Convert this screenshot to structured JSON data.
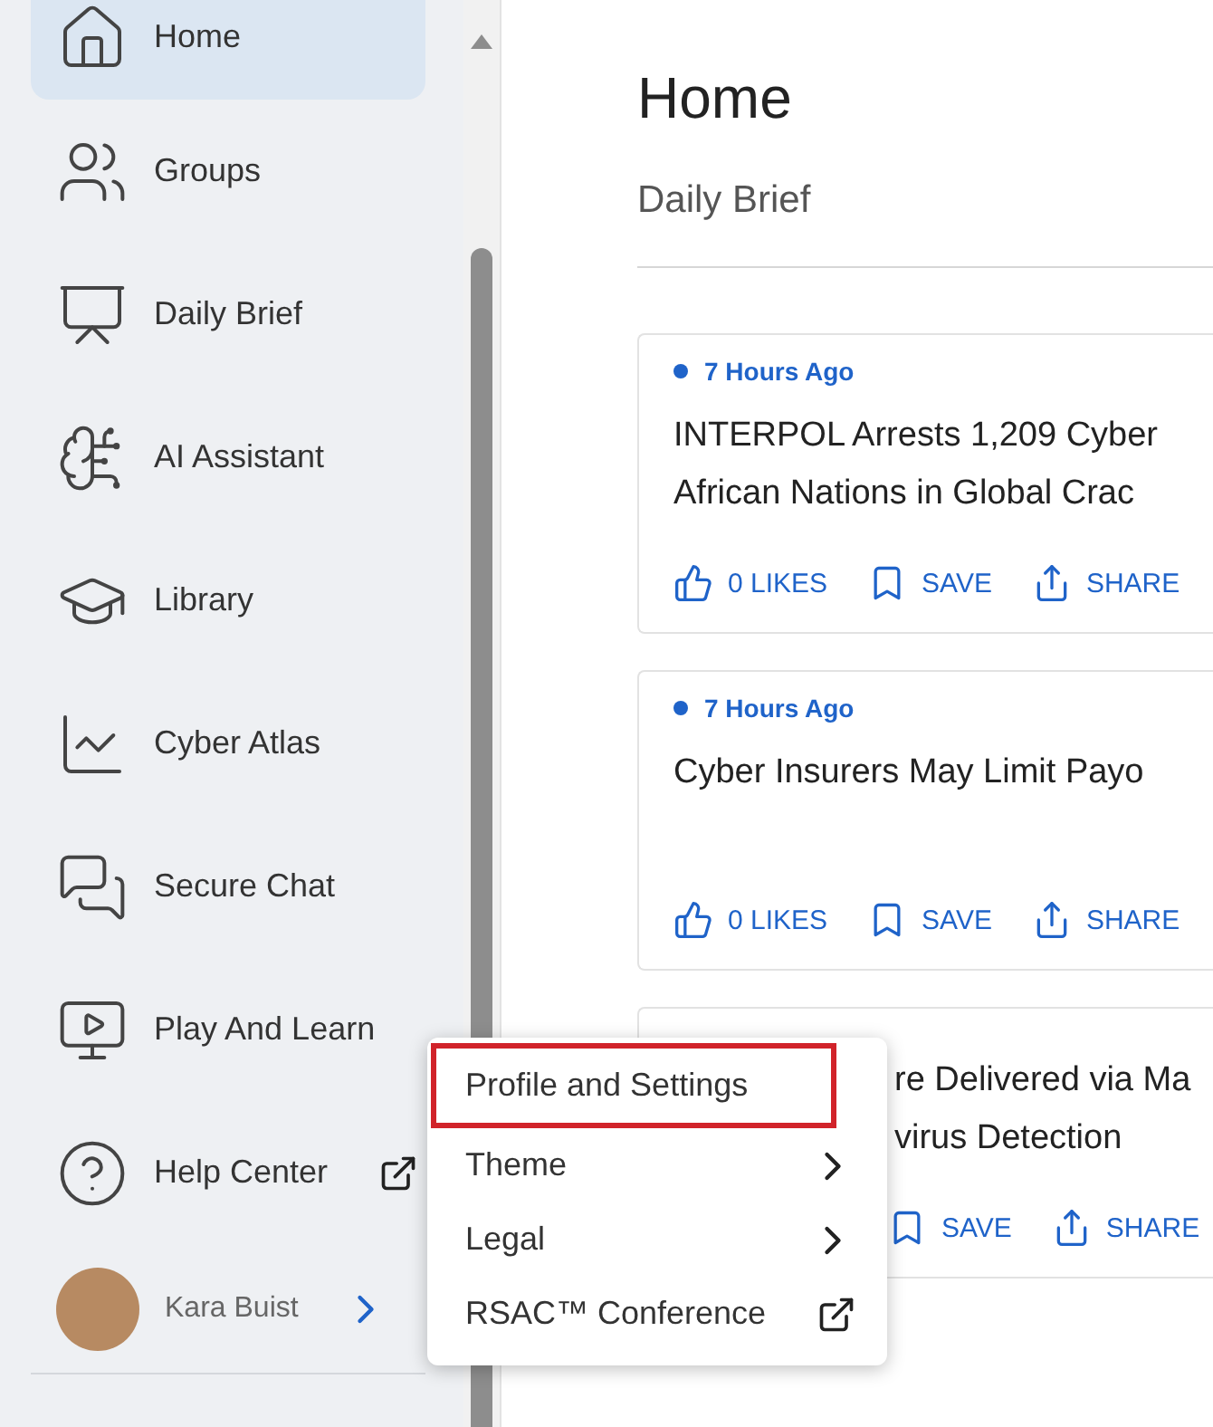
{
  "sidebar": {
    "items": [
      {
        "label": "Home",
        "selected": true,
        "external": false
      },
      {
        "label": "Groups",
        "selected": false,
        "external": false
      },
      {
        "label": "Daily Brief",
        "selected": false,
        "external": false
      },
      {
        "label": "AI Assistant",
        "selected": false,
        "external": false
      },
      {
        "label": "Library",
        "selected": false,
        "external": false
      },
      {
        "label": "Cyber Atlas",
        "selected": false,
        "external": false
      },
      {
        "label": "Secure Chat",
        "selected": false,
        "external": false
      },
      {
        "label": "Play And Learn",
        "selected": false,
        "external": false
      },
      {
        "label": "Help Center",
        "selected": false,
        "external": true
      }
    ],
    "user": {
      "name": "Kara Buist"
    }
  },
  "page": {
    "title": "Home",
    "subtitle": "Daily Brief"
  },
  "cards": [
    {
      "time": "7 Hours Ago",
      "title_lines": [
        "INTERPOL Arrests 1,209 Cyber",
        "African Nations in Global Crac"
      ],
      "covered": false,
      "actions": [
        {
          "kind": "like",
          "label": "0 LIKES"
        },
        {
          "kind": "save",
          "label": "SAVE"
        },
        {
          "kind": "share",
          "label": "SHARE"
        }
      ]
    },
    {
      "time": "7 Hours Ago",
      "title_lines": [
        "Cyber Insurers May Limit Payo"
      ],
      "covered": false,
      "actions": [
        {
          "kind": "like",
          "label": "0 LIKES"
        },
        {
          "kind": "save",
          "label": "SAVE"
        },
        {
          "kind": "share",
          "label": "SHARE"
        }
      ]
    },
    {
      "title_lines": [
        "re Delivered via Ma",
        "virus Detection"
      ],
      "covered": true,
      "actions": [
        {
          "kind": "save",
          "label": "SAVE"
        },
        {
          "kind": "share",
          "label": "SHARE"
        }
      ]
    }
  ],
  "menu": {
    "items": [
      {
        "label": "Profile and Settings",
        "kind": "plain",
        "highlighted": true
      },
      {
        "label": "Theme",
        "kind": "submenu",
        "highlighted": false
      },
      {
        "label": "Legal",
        "kind": "submenu",
        "highlighted": false
      },
      {
        "label": "RSAC™ Conference",
        "kind": "external",
        "highlighted": false
      }
    ]
  }
}
